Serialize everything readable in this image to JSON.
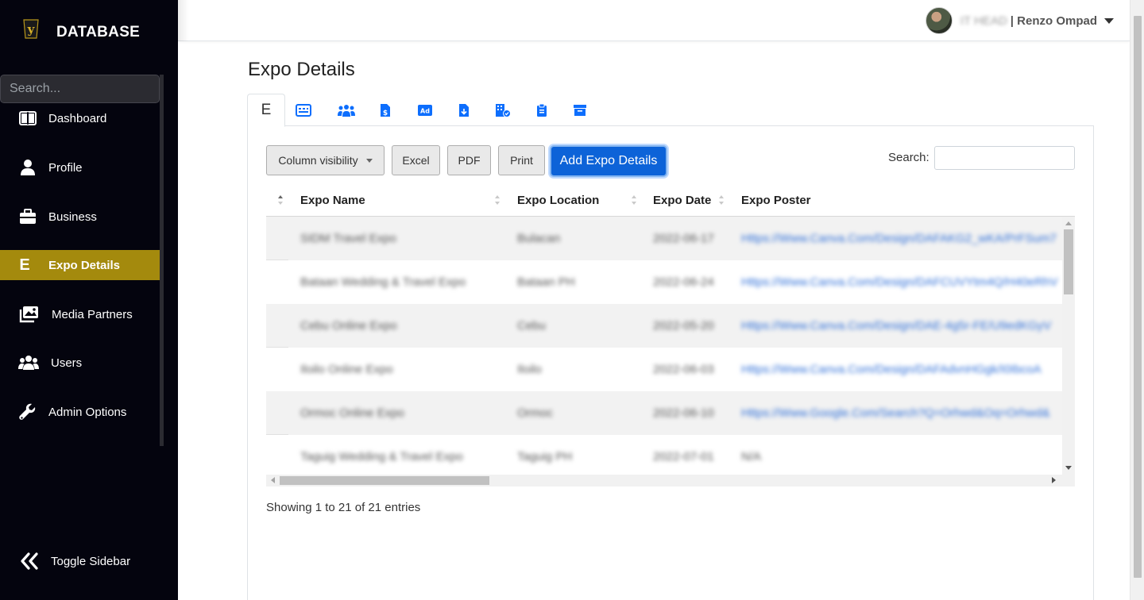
{
  "sidebar": {
    "brand": "DATABASE",
    "search_placeholder": "Search...",
    "items": [
      {
        "label": "Dashboard",
        "icon": "dashboard-columns-icon",
        "active": false
      },
      {
        "label": "Profile",
        "icon": "user-icon",
        "active": false
      },
      {
        "label": "Business",
        "icon": "briefcase-icon",
        "active": false
      },
      {
        "label": "Expo Details",
        "icon": "letter-e-icon",
        "active": true
      },
      {
        "label": "Media Partners",
        "icon": "photos-icon",
        "active": false
      },
      {
        "label": "Users",
        "icon": "users-icon",
        "active": false
      },
      {
        "label": "Admin Options",
        "icon": "wrench-icon",
        "active": false
      }
    ],
    "toggle_label": "Toggle Sidebar"
  },
  "header": {
    "user_role": "IT HEAD",
    "user_name": "| Renzo Ompad"
  },
  "page": {
    "title": "Expo Details",
    "active_tab_label": "E",
    "tabs": [
      "id-card-icon",
      "people-icon",
      "money-file-icon",
      "ad-icon",
      "file-download-icon",
      "building-icon",
      "clipboard-icon",
      "archive-icon"
    ]
  },
  "toolbar": {
    "column_visibility": "Column visibility",
    "excel": "Excel",
    "pdf": "PDF",
    "print": "Print",
    "add": "Add Expo Details",
    "search_label": "Search:"
  },
  "table": {
    "columns": [
      "Expo Name",
      "Expo Location",
      "Expo Date",
      "Expo Poster"
    ],
    "rows": [
      {
        "name": "SIDM Travel Expo",
        "location": "Bulacan",
        "date": "2022-06-17",
        "poster": "Https://Www.Canva.Com/Design/DAFAKG2_wKA/PrFSum7"
      },
      {
        "name": "Bataan Wedding & Travel Expo",
        "location": "Bataan PH",
        "date": "2022-06-24",
        "poster": "Https://Www.Canva.Com/Design/DAFCUVYtm4Q/H40eRhV"
      },
      {
        "name": "Cebu Online Expo",
        "location": "Cebu",
        "date": "2022-05-20",
        "poster": "Https://Www.Canva.Com/Design/DAE-4g5r-FE/U9edKGyV"
      },
      {
        "name": "Iloilo Online Expo",
        "location": "Iloilo",
        "date": "2022-06-03",
        "poster": "Https://Www.Canva.Com/Design/DAFAdvnHGgk/I0IbcoA"
      },
      {
        "name": "Ormoc Online Expo",
        "location": "Ormoc",
        "date": "2022-06-10",
        "poster": "Https://Www.Google.Com/Search?Q=Orhwd&Oq=Orhwd&"
      },
      {
        "name": "Taguig Wedding & Travel Expo",
        "location": "Taguig PH",
        "date": "2022-07-01",
        "poster": "N/A"
      }
    ],
    "info": "Showing 1 to 21 of 21 entries"
  }
}
